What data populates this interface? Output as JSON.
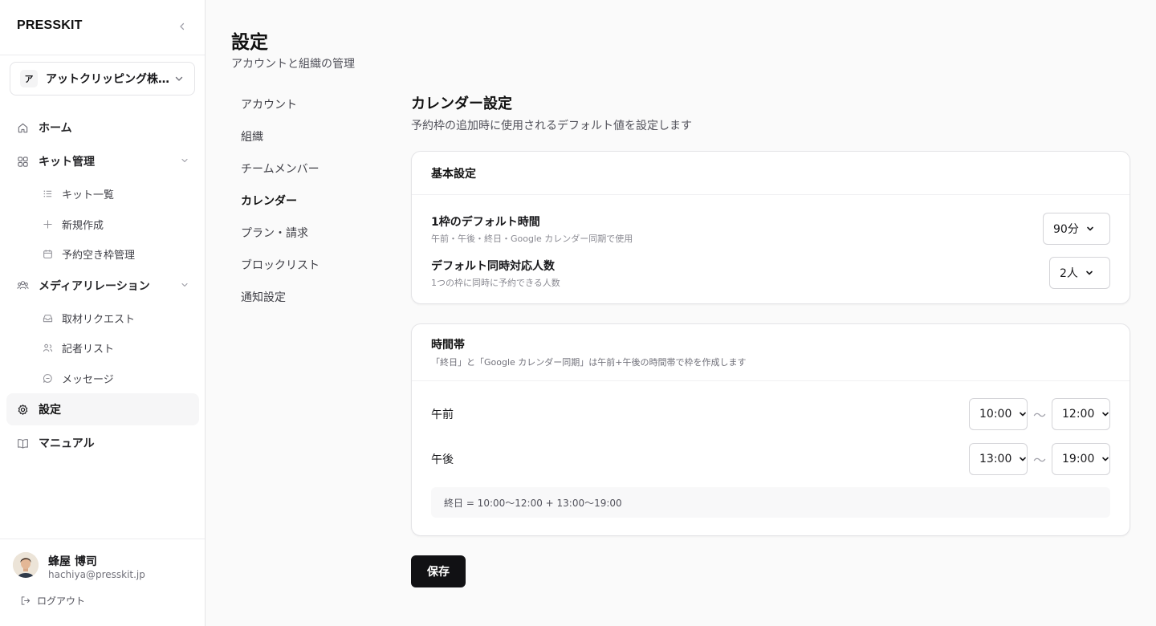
{
  "brand": "PRESSKIT",
  "org": {
    "initial": "ア",
    "name": "アットクリッピング株式会社"
  },
  "nav": {
    "home": "ホーム",
    "kit": "キット管理",
    "kit_list": "キット一覧",
    "kit_new": "新規作成",
    "kit_slots": "予約空き枠管理",
    "media": "メディアリレーション",
    "media_requests": "取材リクエスト",
    "media_reporters": "記者リスト",
    "media_messages": "メッセージ",
    "settings": "設定",
    "manual": "マニュアル"
  },
  "user": {
    "name": "蜂屋 博司",
    "email": "hachiya@presskit.jp",
    "logout": "ログアウト"
  },
  "page": {
    "title": "設定",
    "subtitle": "アカウントと組織の管理"
  },
  "settings_nav": [
    "アカウント",
    "組織",
    "チームメンバー",
    "カレンダー",
    "プラン・請求",
    "ブロックリスト",
    "通知設定"
  ],
  "settings_nav_active": "カレンダー",
  "section": {
    "title": "カレンダー設定",
    "description": "予約枠の追加時に使用されるデフォルト値を設定します"
  },
  "basic": {
    "title": "基本設定",
    "duration_label": "1枠のデフォルト時間",
    "duration_help": "午前・午後・終日・Google カレンダー同期で使用",
    "duration_value": "90分",
    "capacity_label": "デフォルト同時対応人数",
    "capacity_help": "1つの枠に同時に予約できる人数",
    "capacity_value": "2人"
  },
  "timeslots": {
    "title": "時間帯",
    "hint": "「終日」と「Google カレンダー同期」は午前+午後の時間帯で枠を作成します",
    "morning_label": "午前",
    "morning_start": "10:00",
    "morning_end": "12:00",
    "afternoon_label": "午後",
    "afternoon_start": "13:00",
    "afternoon_end": "19:00",
    "separator": "〜",
    "summary": "終日 = 10:00〜12:00 + 13:00〜19:00"
  },
  "save_label": "保存"
}
